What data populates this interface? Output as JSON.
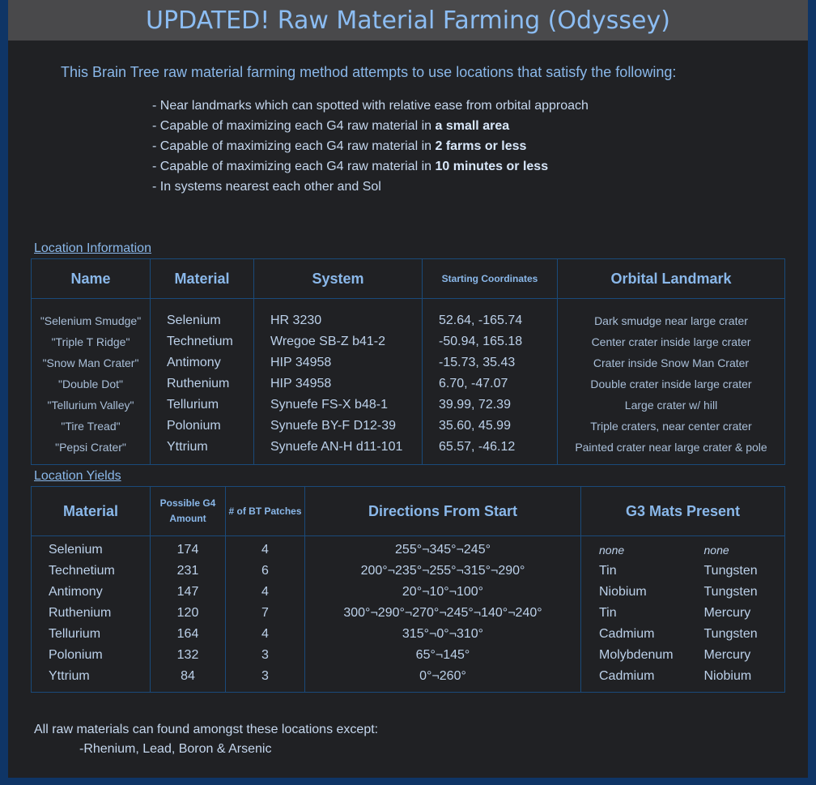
{
  "title": "UPDATED! Raw Material Farming (Odyssey)",
  "intro": "This Brain Tree raw material farming method attempts to use locations that satisfy the following:",
  "bullets": [
    {
      "text": "- Near landmarks which can spotted with relative ease from orbital approach",
      "bold": ""
    },
    {
      "text": "- Capable of maximizing each G4 raw material in ",
      "bold": "a small area"
    },
    {
      "text": "- Capable of maximizing each G4 raw material in ",
      "bold": "2 farms or less"
    },
    {
      "text": "- Capable of maximizing each G4 raw material in ",
      "bold": "10 minutes or less"
    },
    {
      "text": "- In systems nearest each other and Sol",
      "bold": ""
    }
  ],
  "location_info": {
    "label": "Location Information",
    "headers": [
      "Name",
      "Material",
      "System",
      "Starting Coordinates",
      "Orbital Landmark"
    ],
    "rows": [
      [
        "\"Selenium Smudge\"",
        "Selenium",
        "HR 3230",
        "52.64, -165.74",
        "Dark smudge near large crater"
      ],
      [
        "\"Triple T Ridge\"",
        "Technetium",
        "Wregoe SB-Z b41-2",
        "-50.94, 165.18",
        "Center crater inside large crater"
      ],
      [
        "\"Snow Man Crater\"",
        "Antimony",
        "HIP 34958",
        "-15.73, 35.43",
        "Crater inside Snow Man Crater"
      ],
      [
        "\"Double Dot\"",
        "Ruthenium",
        "HIP 34958",
        "6.70, -47.07",
        "Double crater inside large crater"
      ],
      [
        "\"Tellurium Valley\"",
        "Tellurium",
        "Synuefe FS-X b48-1",
        "39.99, 72.39",
        "Large crater w/ hill"
      ],
      [
        "\"Tire Tread\"",
        "Polonium",
        "Synuefe BY-F D12-39",
        "35.60, 45.99",
        "Triple craters, near center crater"
      ],
      [
        "\"Pepsi Crater\"",
        "Yttrium",
        "Synuefe AN-H d11-101",
        "65.57, -46.12",
        "Painted crater near large crater & pole"
      ]
    ]
  },
  "yields": {
    "label": "Location Yields",
    "headers": [
      "Material",
      "Possible G4 Amount",
      "# of BT Patches",
      "Directions From Start",
      "G3 Mats Present"
    ],
    "rows": [
      [
        "Selenium",
        "174",
        "4",
        "255°¬345°¬245°",
        "none",
        "none"
      ],
      [
        "Technetium",
        "231",
        "6",
        "200°¬235°¬255°¬315°¬290°",
        "Tin",
        "Tungsten"
      ],
      [
        "Antimony",
        "147",
        "4",
        "20°¬10°¬100°",
        "Niobium",
        "Tungsten"
      ],
      [
        "Ruthenium",
        "120",
        "7",
        "300°¬290°¬270°¬245°¬140°¬240°",
        "Tin",
        "Mercury"
      ],
      [
        "Tellurium",
        "164",
        "4",
        "315°¬0°¬310°",
        "Cadmium",
        "Tungsten"
      ],
      [
        "Polonium",
        "132",
        "3",
        "65°¬145°",
        "Molybdenum",
        "Mercury"
      ],
      [
        "Yttrium",
        "84",
        "3",
        "0°¬260°",
        "Cadmium",
        "Niobium"
      ]
    ]
  },
  "footer": {
    "line1": "All raw materials can found amongst these locations except:",
    "line2": "-Rhenium, Lead, Boron & Arsenic"
  }
}
